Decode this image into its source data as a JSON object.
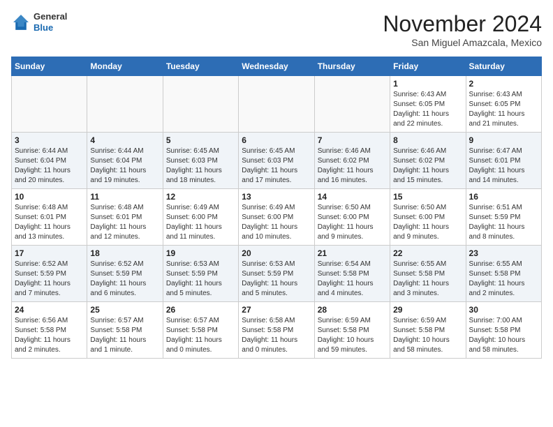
{
  "header": {
    "logo_line1": "General",
    "logo_line2": "Blue",
    "month": "November 2024",
    "location": "San Miguel Amazcala, Mexico"
  },
  "weekdays": [
    "Sunday",
    "Monday",
    "Tuesday",
    "Wednesday",
    "Thursday",
    "Friday",
    "Saturday"
  ],
  "weeks": [
    [
      {
        "day": "",
        "info": ""
      },
      {
        "day": "",
        "info": ""
      },
      {
        "day": "",
        "info": ""
      },
      {
        "day": "",
        "info": ""
      },
      {
        "day": "",
        "info": ""
      },
      {
        "day": "1",
        "info": "Sunrise: 6:43 AM\nSunset: 6:05 PM\nDaylight: 11 hours\nand 22 minutes."
      },
      {
        "day": "2",
        "info": "Sunrise: 6:43 AM\nSunset: 6:05 PM\nDaylight: 11 hours\nand 21 minutes."
      }
    ],
    [
      {
        "day": "3",
        "info": "Sunrise: 6:44 AM\nSunset: 6:04 PM\nDaylight: 11 hours\nand 20 minutes."
      },
      {
        "day": "4",
        "info": "Sunrise: 6:44 AM\nSunset: 6:04 PM\nDaylight: 11 hours\nand 19 minutes."
      },
      {
        "day": "5",
        "info": "Sunrise: 6:45 AM\nSunset: 6:03 PM\nDaylight: 11 hours\nand 18 minutes."
      },
      {
        "day": "6",
        "info": "Sunrise: 6:45 AM\nSunset: 6:03 PM\nDaylight: 11 hours\nand 17 minutes."
      },
      {
        "day": "7",
        "info": "Sunrise: 6:46 AM\nSunset: 6:02 PM\nDaylight: 11 hours\nand 16 minutes."
      },
      {
        "day": "8",
        "info": "Sunrise: 6:46 AM\nSunset: 6:02 PM\nDaylight: 11 hours\nand 15 minutes."
      },
      {
        "day": "9",
        "info": "Sunrise: 6:47 AM\nSunset: 6:01 PM\nDaylight: 11 hours\nand 14 minutes."
      }
    ],
    [
      {
        "day": "10",
        "info": "Sunrise: 6:48 AM\nSunset: 6:01 PM\nDaylight: 11 hours\nand 13 minutes."
      },
      {
        "day": "11",
        "info": "Sunrise: 6:48 AM\nSunset: 6:01 PM\nDaylight: 11 hours\nand 12 minutes."
      },
      {
        "day": "12",
        "info": "Sunrise: 6:49 AM\nSunset: 6:00 PM\nDaylight: 11 hours\nand 11 minutes."
      },
      {
        "day": "13",
        "info": "Sunrise: 6:49 AM\nSunset: 6:00 PM\nDaylight: 11 hours\nand 10 minutes."
      },
      {
        "day": "14",
        "info": "Sunrise: 6:50 AM\nSunset: 6:00 PM\nDaylight: 11 hours\nand 9 minutes."
      },
      {
        "day": "15",
        "info": "Sunrise: 6:50 AM\nSunset: 6:00 PM\nDaylight: 11 hours\nand 9 minutes."
      },
      {
        "day": "16",
        "info": "Sunrise: 6:51 AM\nSunset: 5:59 PM\nDaylight: 11 hours\nand 8 minutes."
      }
    ],
    [
      {
        "day": "17",
        "info": "Sunrise: 6:52 AM\nSunset: 5:59 PM\nDaylight: 11 hours\nand 7 minutes."
      },
      {
        "day": "18",
        "info": "Sunrise: 6:52 AM\nSunset: 5:59 PM\nDaylight: 11 hours\nand 6 minutes."
      },
      {
        "day": "19",
        "info": "Sunrise: 6:53 AM\nSunset: 5:59 PM\nDaylight: 11 hours\nand 5 minutes."
      },
      {
        "day": "20",
        "info": "Sunrise: 6:53 AM\nSunset: 5:59 PM\nDaylight: 11 hours\nand 5 minutes."
      },
      {
        "day": "21",
        "info": "Sunrise: 6:54 AM\nSunset: 5:58 PM\nDaylight: 11 hours\nand 4 minutes."
      },
      {
        "day": "22",
        "info": "Sunrise: 6:55 AM\nSunset: 5:58 PM\nDaylight: 11 hours\nand 3 minutes."
      },
      {
        "day": "23",
        "info": "Sunrise: 6:55 AM\nSunset: 5:58 PM\nDaylight: 11 hours\nand 2 minutes."
      }
    ],
    [
      {
        "day": "24",
        "info": "Sunrise: 6:56 AM\nSunset: 5:58 PM\nDaylight: 11 hours\nand 2 minutes."
      },
      {
        "day": "25",
        "info": "Sunrise: 6:57 AM\nSunset: 5:58 PM\nDaylight: 11 hours\nand 1 minute."
      },
      {
        "day": "26",
        "info": "Sunrise: 6:57 AM\nSunset: 5:58 PM\nDaylight: 11 hours\nand 0 minutes."
      },
      {
        "day": "27",
        "info": "Sunrise: 6:58 AM\nSunset: 5:58 PM\nDaylight: 11 hours\nand 0 minutes."
      },
      {
        "day": "28",
        "info": "Sunrise: 6:59 AM\nSunset: 5:58 PM\nDaylight: 10 hours\nand 59 minutes."
      },
      {
        "day": "29",
        "info": "Sunrise: 6:59 AM\nSunset: 5:58 PM\nDaylight: 10 hours\nand 58 minutes."
      },
      {
        "day": "30",
        "info": "Sunrise: 7:00 AM\nSunset: 5:58 PM\nDaylight: 10 hours\nand 58 minutes."
      }
    ]
  ]
}
